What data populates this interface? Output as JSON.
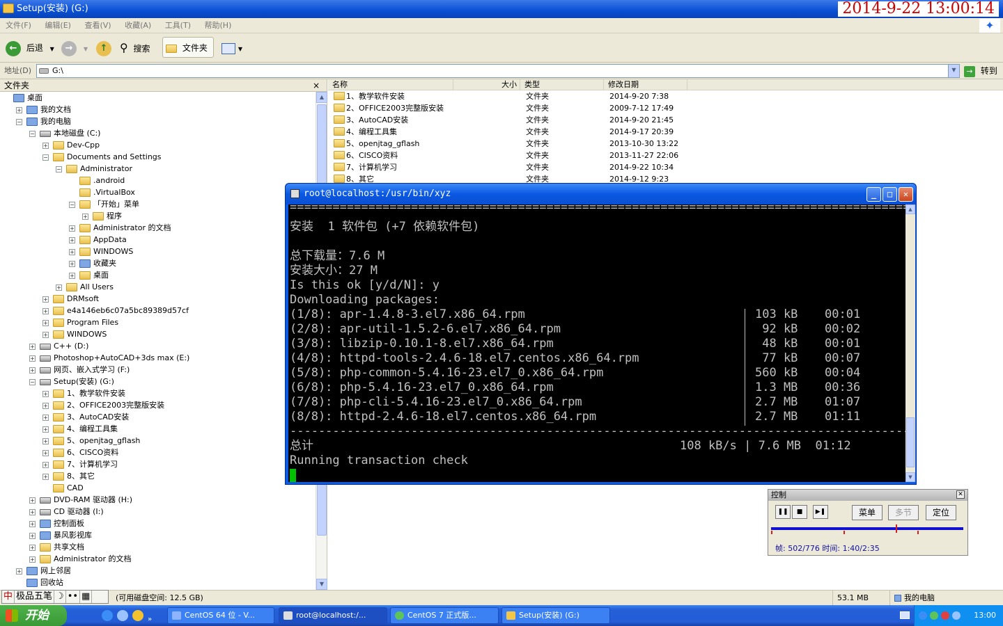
{
  "explorer": {
    "title": "Setup(安装) (G:)",
    "timestamp_overlay": "2014-9-22 13:00:14",
    "menu": [
      "文件(F)",
      "编辑(E)",
      "查看(V)",
      "收藏(A)",
      "工具(T)",
      "帮助(H)"
    ],
    "toolbar": {
      "back": "后退",
      "search": "搜索",
      "folders": "文件夹"
    },
    "address": {
      "label": "地址(D)",
      "value": "G:\\",
      "go": "转到"
    },
    "folder_pane": {
      "title": "文件夹",
      "close": "×",
      "tree": [
        {
          "label": "桌面",
          "indent": 0,
          "exp": "",
          "icon": "special"
        },
        {
          "label": "我的文档",
          "indent": 1,
          "exp": "+",
          "icon": "special"
        },
        {
          "label": "我的电脑",
          "indent": 1,
          "exp": "−",
          "icon": "special"
        },
        {
          "label": "本地磁盘 (C:)",
          "indent": 2,
          "exp": "−",
          "icon": "drive"
        },
        {
          "label": "Dev-Cpp",
          "indent": 3,
          "exp": "+",
          "icon": "folder"
        },
        {
          "label": "Documents and Settings",
          "indent": 3,
          "exp": "−",
          "icon": "folder"
        },
        {
          "label": "Administrator",
          "indent": 4,
          "exp": "−",
          "icon": "folder"
        },
        {
          "label": ".android",
          "indent": 5,
          "exp": "",
          "icon": "folder"
        },
        {
          "label": ".VirtualBox",
          "indent": 5,
          "exp": "",
          "icon": "folder"
        },
        {
          "label": "「开始」菜单",
          "indent": 5,
          "exp": "−",
          "icon": "folder"
        },
        {
          "label": "程序",
          "indent": 6,
          "exp": "+",
          "icon": "folder"
        },
        {
          "label": "Administrator 的文档",
          "indent": 5,
          "exp": "+",
          "icon": "folder"
        },
        {
          "label": "AppData",
          "indent": 5,
          "exp": "+",
          "icon": "folder"
        },
        {
          "label": "WINDOWS",
          "indent": 5,
          "exp": "+",
          "icon": "folder"
        },
        {
          "label": "收藏夹",
          "indent": 5,
          "exp": "+",
          "icon": "special"
        },
        {
          "label": "桌面",
          "indent": 5,
          "exp": "+",
          "icon": "folder"
        },
        {
          "label": "All Users",
          "indent": 4,
          "exp": "+",
          "icon": "folder"
        },
        {
          "label": "DRMsoft",
          "indent": 3,
          "exp": "+",
          "icon": "folder"
        },
        {
          "label": "e4a146eb6c07a5bc89389d57cf",
          "indent": 3,
          "exp": "+",
          "icon": "folder"
        },
        {
          "label": "Program Files",
          "indent": 3,
          "exp": "+",
          "icon": "folder"
        },
        {
          "label": "WINDOWS",
          "indent": 3,
          "exp": "+",
          "icon": "folder"
        },
        {
          "label": "C++ (D:)",
          "indent": 2,
          "exp": "+",
          "icon": "drive"
        },
        {
          "label": "Photoshop+AutoCAD+3ds max (E:)",
          "indent": 2,
          "exp": "+",
          "icon": "drive"
        },
        {
          "label": "网页、嵌入式学习 (F:)",
          "indent": 2,
          "exp": "+",
          "icon": "drive"
        },
        {
          "label": "Setup(安装) (G:)",
          "indent": 2,
          "exp": "−",
          "icon": "drive"
        },
        {
          "label": "1、教学软件安装",
          "indent": 3,
          "exp": "+",
          "icon": "folder"
        },
        {
          "label": "2、OFFICE2003完整版安装",
          "indent": 3,
          "exp": "+",
          "icon": "folder"
        },
        {
          "label": "3、AutoCAD安装",
          "indent": 3,
          "exp": "+",
          "icon": "folder"
        },
        {
          "label": "4、编程工具集",
          "indent": 3,
          "exp": "+",
          "icon": "folder"
        },
        {
          "label": "5、openjtag_gflash",
          "indent": 3,
          "exp": "+",
          "icon": "folder"
        },
        {
          "label": "6、CISCO资料",
          "indent": 3,
          "exp": "+",
          "icon": "folder"
        },
        {
          "label": "7、计算机学习",
          "indent": 3,
          "exp": "+",
          "icon": "folder"
        },
        {
          "label": "8、其它",
          "indent": 3,
          "exp": "+",
          "icon": "folder"
        },
        {
          "label": "CAD",
          "indent": 3,
          "exp": "",
          "icon": "folder"
        },
        {
          "label": "DVD-RAM 驱动器 (H:)",
          "indent": 2,
          "exp": "+",
          "icon": "drive"
        },
        {
          "label": "CD 驱动器 (I:)",
          "indent": 2,
          "exp": "+",
          "icon": "drive"
        },
        {
          "label": "控制面板",
          "indent": 2,
          "exp": "+",
          "icon": "special"
        },
        {
          "label": "暴风影视库",
          "indent": 2,
          "exp": "+",
          "icon": "special"
        },
        {
          "label": "共享文档",
          "indent": 2,
          "exp": "+",
          "icon": "folder"
        },
        {
          "label": "Administrator 的文档",
          "indent": 2,
          "exp": "+",
          "icon": "folder"
        },
        {
          "label": "网上邻居",
          "indent": 1,
          "exp": "+",
          "icon": "special"
        },
        {
          "label": "回收站",
          "indent": 1,
          "exp": "",
          "icon": "special"
        }
      ]
    },
    "file_list": {
      "columns": {
        "name": "名称",
        "size": "大小",
        "type": "类型",
        "modified": "修改日期"
      },
      "rows": [
        {
          "name": "1、教学软件安装",
          "type": "文件夹",
          "modified": "2014-9-20 7:38"
        },
        {
          "name": "2、OFFICE2003完整版安装",
          "type": "文件夹",
          "modified": "2009-7-12 17:49"
        },
        {
          "name": "3、AutoCAD安装",
          "type": "文件夹",
          "modified": "2014-9-20 21:45"
        },
        {
          "name": "4、编程工具集",
          "type": "文件夹",
          "modified": "2014-9-17 20:39"
        },
        {
          "name": "5、openjtag_gflash",
          "type": "文件夹",
          "modified": "2013-10-30 13:22"
        },
        {
          "name": "6、CISCO资料",
          "type": "文件夹",
          "modified": "2013-11-27 22:06"
        },
        {
          "name": "7、计算机学习",
          "type": "文件夹",
          "modified": "2014-9-22 10:34"
        },
        {
          "name": "8、其它",
          "type": "文件夹",
          "modified": "2014-9-12 9:23"
        }
      ]
    },
    "statusbar": {
      "free_space": "(可用磁盘空间: 12.5 GB)",
      "size": "53.1 MB",
      "location": "我的电脑"
    }
  },
  "ime": {
    "items": [
      "中",
      "极品五笔",
      "☽",
      "••",
      "▦"
    ]
  },
  "terminal": {
    "title": "root@localhost:/usr/bin/xyz",
    "separator_top": "================================================================================================",
    "install_line": "安装  1 软件包 (+7 依赖软件包)",
    "download_size": "总下载量：7.6 M",
    "install_size": "安装大小：27 M",
    "prompt": "Is this ok [y/d/N]: y",
    "downloading": "Downloading packages:",
    "packages": [
      {
        "name": "(1/8): apr-1.4.8-3.el7.x86_64.rpm",
        "size": "103 kB",
        "time": "00:01"
      },
      {
        "name": "(2/8): apr-util-1.5.2-6.el7.x86_64.rpm",
        "size": " 92 kB",
        "time": "00:02"
      },
      {
        "name": "(3/8): libzip-0.10.1-8.el7.x86_64.rpm",
        "size": " 48 kB",
        "time": "00:01"
      },
      {
        "name": "(4/8): httpd-tools-2.4.6-18.el7.centos.x86_64.rpm",
        "size": " 77 kB",
        "time": "00:07"
      },
      {
        "name": "(5/8): php-common-5.4.16-23.el7_0.x86_64.rpm",
        "size": "560 kB",
        "time": "00:04"
      },
      {
        "name": "(6/8): php-5.4.16-23.el7_0.x86_64.rpm",
        "size": "1.3 MB",
        "time": "00:36"
      },
      {
        "name": "(7/8): php-cli-5.4.16-23.el7_0.x86_64.rpm",
        "size": "2.7 MB",
        "time": "01:07"
      },
      {
        "name": "(8/8): httpd-2.4.6-18.el7.centos.x86_64.rpm",
        "size": "2.7 MB",
        "time": "01:11"
      }
    ],
    "separator_bottom": "------------------------------------------------------------------------------------------------",
    "total_label": "总计",
    "total_value": "108 kB/s | 7.6 MB  01:12",
    "running": "Running transaction check"
  },
  "control_panel": {
    "title": "控制",
    "buttons": {
      "menu": "菜单",
      "multi": "多节",
      "locate": "定位"
    },
    "status": "帧: 502/776 时间: 1:40/2:35",
    "progress": 0.647
  },
  "taskbar": {
    "start": "开始",
    "tasks": [
      "CentOS 64 位 - V...",
      "root@localhost:/...",
      "CentOS 7 正式版...",
      "Setup(安装) (G:)"
    ],
    "clock": "13:00"
  },
  "colors": {
    "xp_blue": "#0a4fd3",
    "terminal_bg": "#000000",
    "terminal_fg": "#c0c0c0",
    "cursor": "#00c000",
    "overlay_red": "#cc0000"
  }
}
